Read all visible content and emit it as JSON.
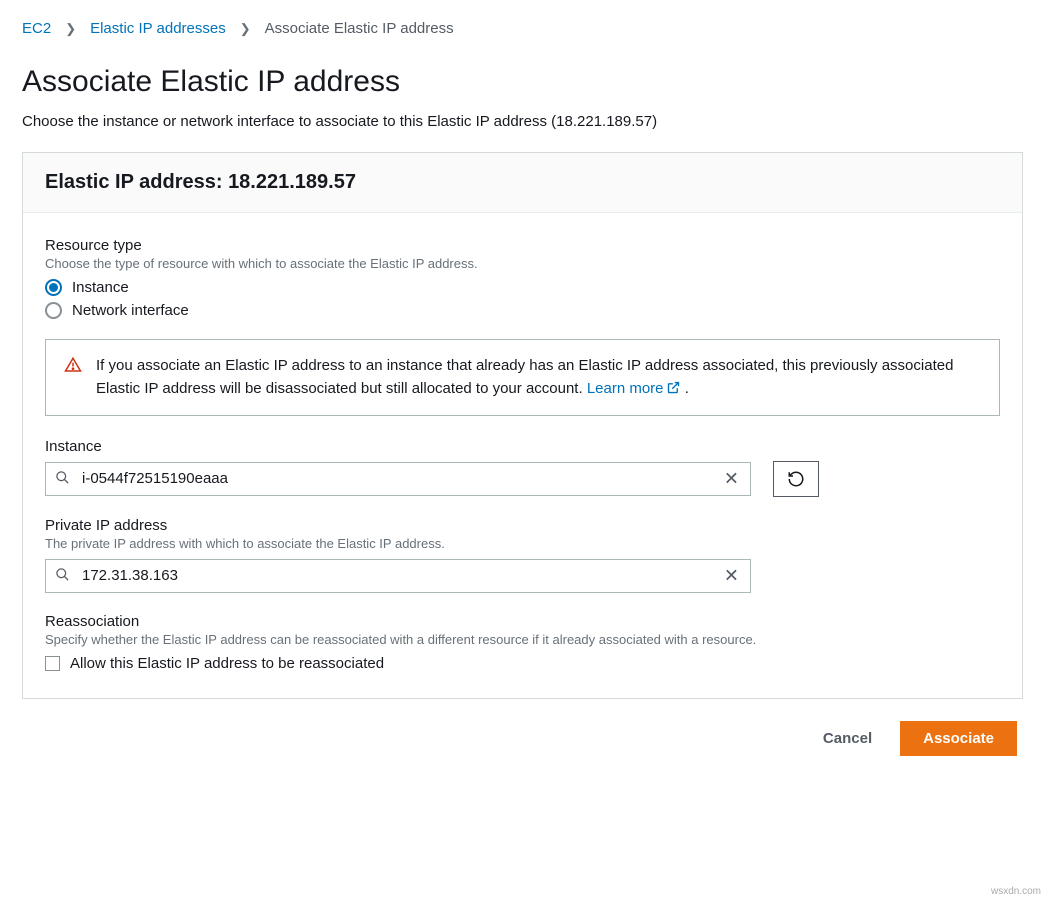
{
  "breadcrumb": {
    "root": "EC2",
    "parent": "Elastic IP addresses",
    "current": "Associate Elastic IP address"
  },
  "page": {
    "title": "Associate Elastic IP address",
    "subtitle": "Choose the instance or network interface to associate to this Elastic IP address (18.221.189.57)"
  },
  "panel": {
    "header_label": "Elastic IP address: ",
    "header_ip": "18.221.189.57"
  },
  "resource_type": {
    "label": "Resource type",
    "help": "Choose the type of resource with which to associate the Elastic IP address.",
    "options": {
      "instance": "Instance",
      "network_interface": "Network interface"
    },
    "selected": "instance"
  },
  "warning": {
    "text": "If you associate an Elastic IP address to an instance that already has an Elastic IP address associated, this previously associated Elastic IP address will be disassociated but still allocated to your account. ",
    "link_text": "Learn more",
    "trailing": " ."
  },
  "instance": {
    "label": "Instance",
    "value": "i-0544f72515190eaaa"
  },
  "private_ip": {
    "label": "Private IP address",
    "help": "The private IP address with which to associate the Elastic IP address.",
    "value": "172.31.38.163"
  },
  "reassociation": {
    "label": "Reassociation",
    "help": "Specify whether the Elastic IP address can be reassociated with a different resource if it already associated with a resource.",
    "checkbox_label": "Allow this Elastic IP address to be reassociated"
  },
  "footer": {
    "cancel": "Cancel",
    "associate": "Associate"
  },
  "watermark": "wsxdn.com"
}
